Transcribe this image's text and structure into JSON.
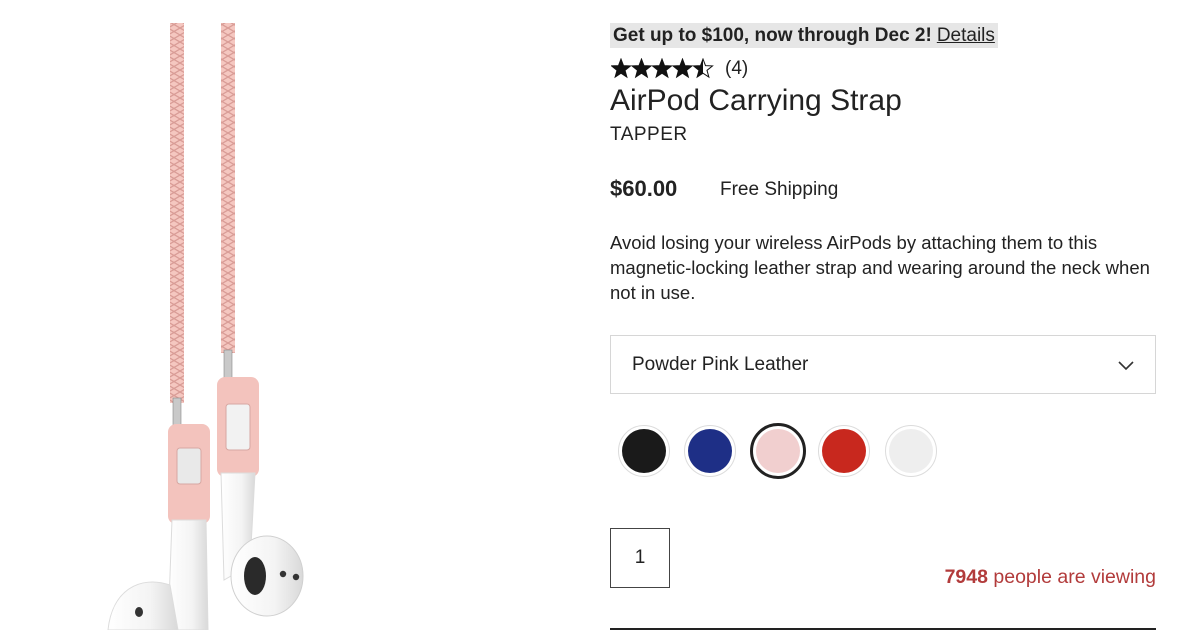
{
  "promo": {
    "text": "Get up to $100, now through Dec 2!",
    "details_label": "Details"
  },
  "rating": {
    "stars": 4.5,
    "max_stars": 5,
    "count_label": "(4)"
  },
  "product": {
    "title": "AirPod Carrying Strap",
    "brand": "TAPPER",
    "price": "$60.00",
    "shipping": "Free Shipping",
    "description": "Avoid losing your wireless AirPods by attaching them to this magnetic-locking leather strap and wearing around the neck when not in use."
  },
  "variant_select": {
    "selected": "Powder Pink Leather"
  },
  "swatches": [
    {
      "icon": "black-leather-swatch",
      "color": "#1a1a1a",
      "selected": false
    },
    {
      "icon": "navy-leather-swatch",
      "color": "#1e2f86",
      "selected": false
    },
    {
      "icon": "pink-leather-swatch",
      "color": "#f1cfcf",
      "selected": true
    },
    {
      "icon": "red-leather-swatch",
      "color": "#c8281e",
      "selected": false
    },
    {
      "icon": "white-marble-swatch",
      "color": "#eeeeee",
      "selected": false
    }
  ],
  "quantity": {
    "value": "1"
  },
  "viewing": {
    "count": "7948",
    "label": "people are viewing"
  },
  "colors": {
    "accent_red": "#b23b3b",
    "strap_pink": "#f3c3bd"
  }
}
